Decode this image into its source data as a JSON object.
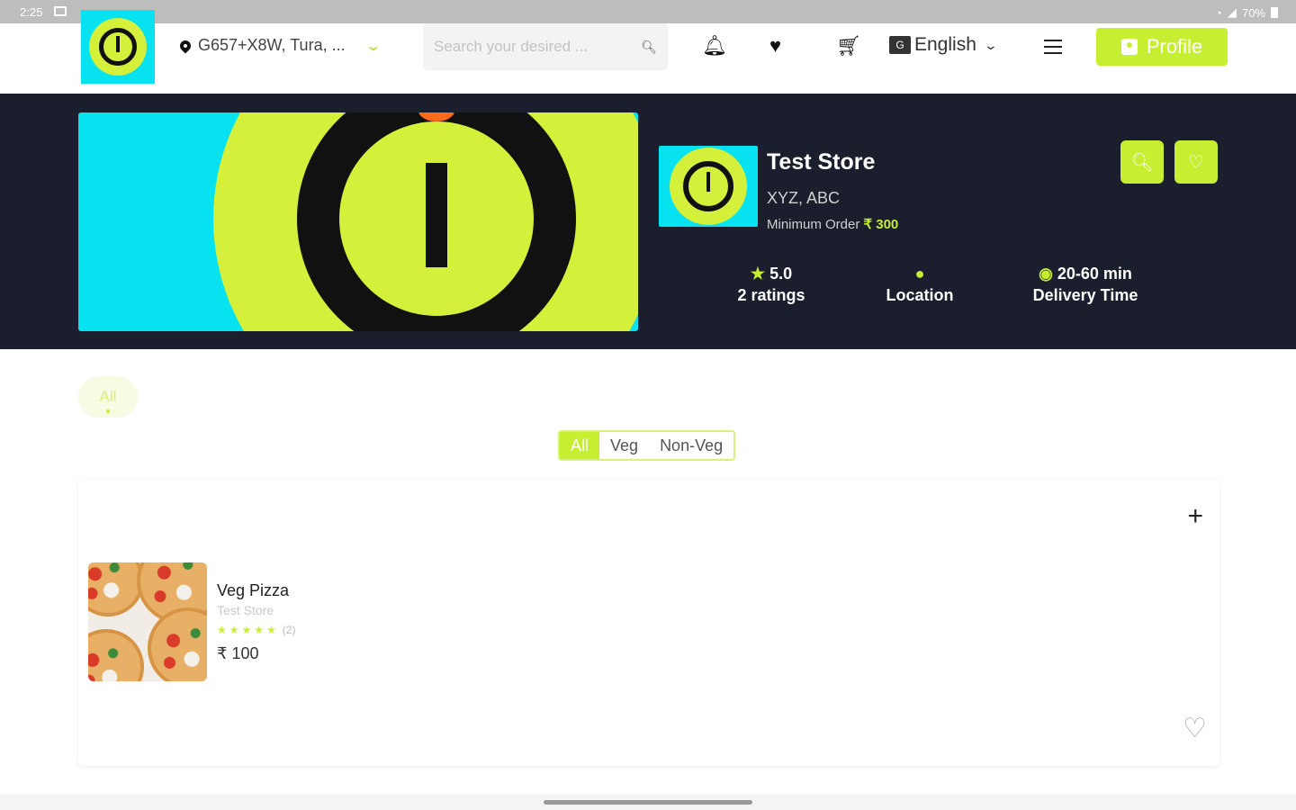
{
  "status_bar": {
    "time": "2:25",
    "battery": "70%"
  },
  "header": {
    "location": "G657+X8W, Tura, ...",
    "search_placeholder": "Search your desired ...",
    "language": "English",
    "profile_label": "Profile"
  },
  "store": {
    "name": "Test Store",
    "address": "XYZ, ABC",
    "min_order_label": "Minimum Order",
    "min_order_value": "₹ 300",
    "rating": "5.0",
    "ratings_count": "2 ratings",
    "location_label": "Location",
    "delivery_time": "20-60 min",
    "delivery_label": "Delivery Time"
  },
  "categories": [
    {
      "label": "All"
    }
  ],
  "filters": [
    {
      "label": "All",
      "active": true
    },
    {
      "label": "Veg"
    },
    {
      "label": "Non-Veg"
    }
  ],
  "items": [
    {
      "name": "Veg Pizza",
      "store": "Test Store",
      "stars": "★★★★★",
      "rating_count": "(2)",
      "price": "₹ 100"
    }
  ],
  "colors": {
    "accent": "#c7ef31",
    "banner_bg": "#1b1e2c",
    "logo_cyan": "#06e2ef"
  },
  "icons": [
    "pin-icon",
    "chevron-down-icon",
    "search-icon",
    "bell-icon",
    "heart-icon",
    "cart-icon",
    "translate-icon",
    "menu-icon",
    "profile-icon",
    "star-icon",
    "clock-icon",
    "plus-icon"
  ]
}
